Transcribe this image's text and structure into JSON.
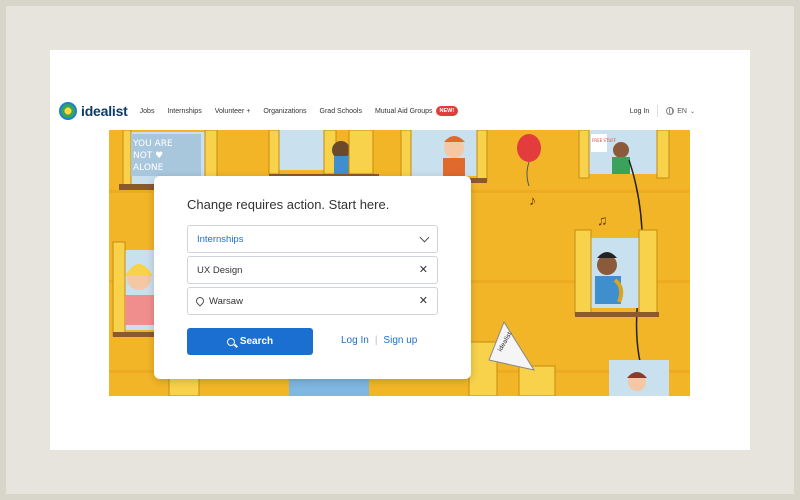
{
  "header": {
    "logo_text": "idealist",
    "nav": [
      {
        "label": "Jobs"
      },
      {
        "label": "Internships"
      },
      {
        "label": "Volunteer +"
      },
      {
        "label": "Organizations"
      },
      {
        "label": "Grad Schools"
      },
      {
        "label": "Mutual Aid Groups",
        "badge": "NEW!"
      }
    ],
    "login": "Log In",
    "language": "EN"
  },
  "hero": {
    "sign_text_1": "YOU ARE",
    "sign_text_2": "NOT ♥",
    "sign_text_3": "ALONE",
    "small_sign": "FREE STUFF",
    "flag_text": "idealist"
  },
  "search_card": {
    "title": "Change requires action. Start here.",
    "type_select": "Internships",
    "keyword_input": "UX Design",
    "location_input": "Warsaw",
    "search_button": "Search",
    "login_link": "Log In",
    "separator": "|",
    "signup_link": "Sign up"
  },
  "colors": {
    "accent": "#1b6fd1",
    "hero_bg": "#f2b528",
    "badge": "#e23c3c"
  }
}
